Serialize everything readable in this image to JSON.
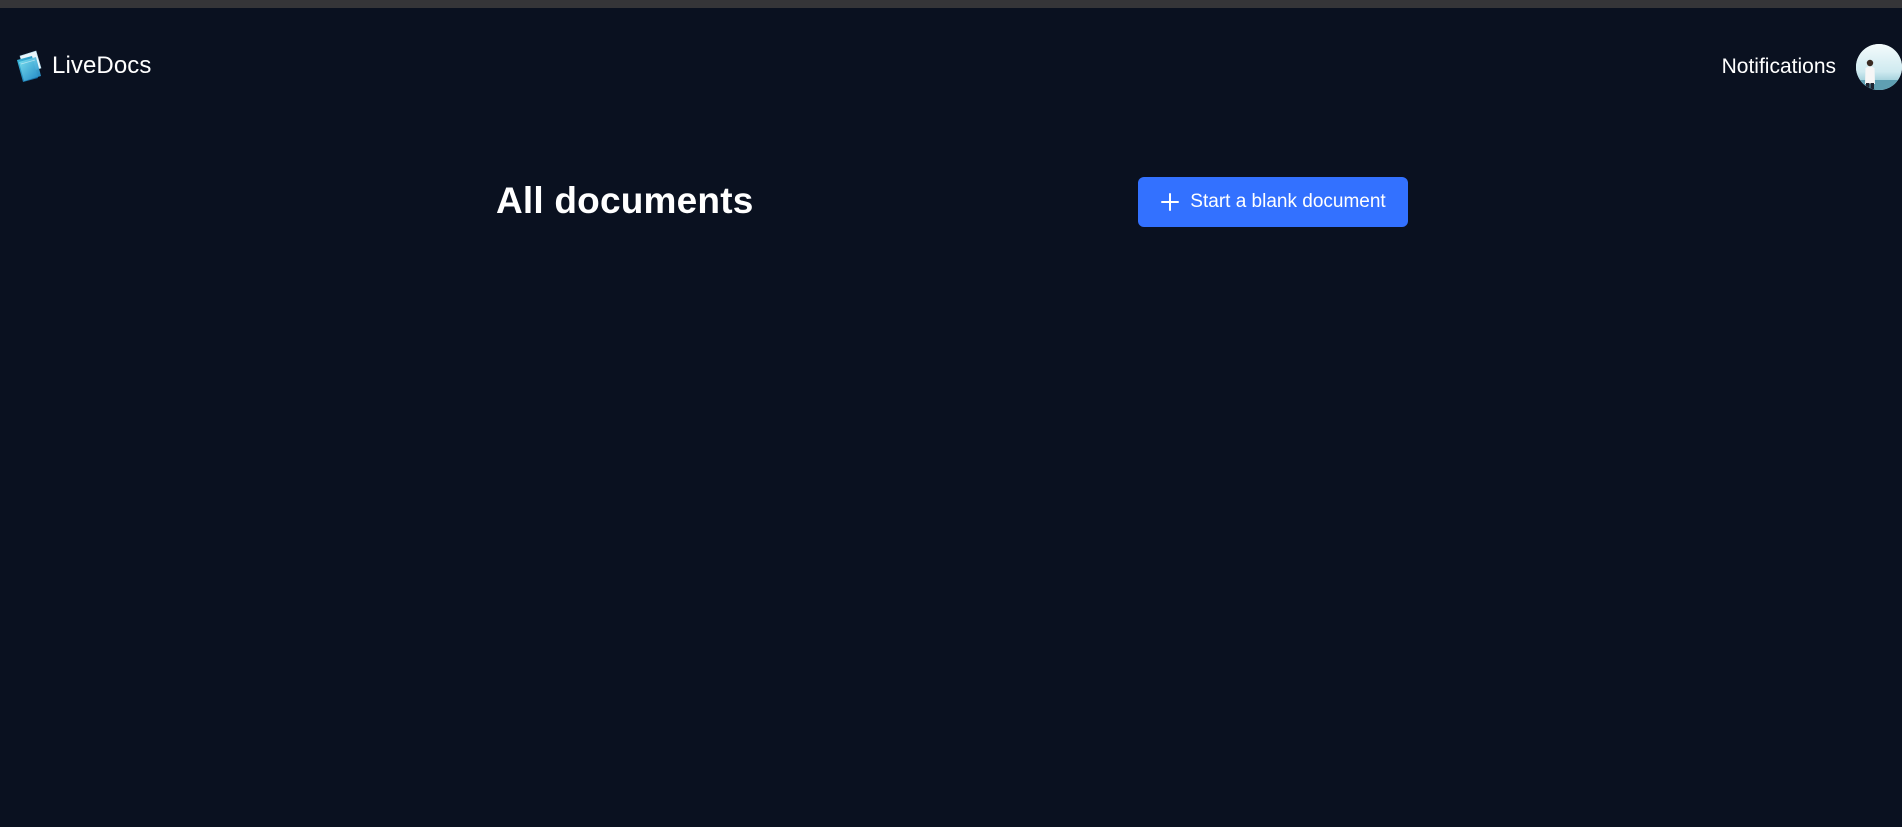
{
  "app": {
    "name": "LiveDocs",
    "logo_icon": "folder-docs-icon"
  },
  "header": {
    "notifications_label": "Notifications",
    "avatar_icon": "user-avatar"
  },
  "main": {
    "title": "All documents",
    "new_document_button": {
      "label": "Start a blank document",
      "icon": "plus-icon"
    }
  },
  "colors": {
    "background": "#0a1120",
    "accent": "#3371ff",
    "browser_strip": "#353538"
  }
}
